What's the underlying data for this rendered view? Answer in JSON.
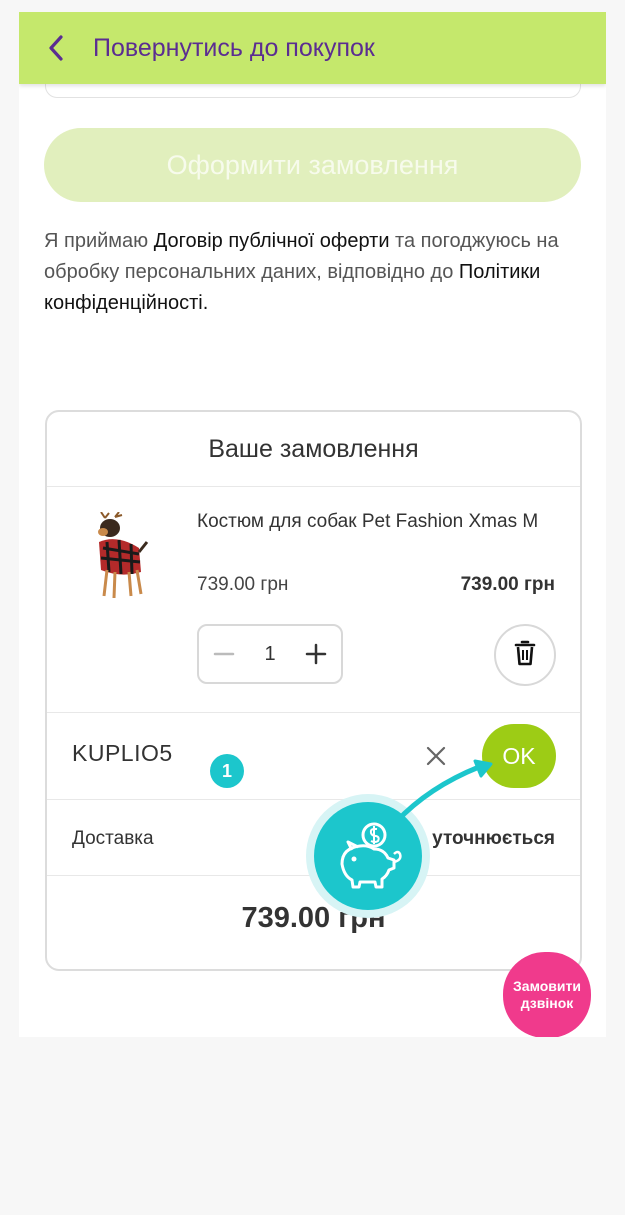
{
  "header": {
    "back_label": "Повернутись до покупок"
  },
  "checkout": {
    "button_label": "Оформити замовлення"
  },
  "consent": {
    "text_1": "Я приймаю ",
    "link_offer": "Договір публічної оферти",
    "text_2": " та погоджуюсь на обробку персональних даних, відповідно до ",
    "link_privacy": "Політики конфіденційності."
  },
  "order": {
    "title": "Ваше замовлення",
    "item": {
      "name": "Костюм для собак Pet Fashion Xmas M",
      "unit_price": "739.00 грн",
      "line_total": "739.00 грн",
      "quantity": "1"
    },
    "promo": {
      "code": "KUPLIO5",
      "step": "1",
      "apply_label": "OK"
    },
    "delivery": {
      "label": "Доставка",
      "value": "уточнюється"
    },
    "total": "739.00 грн"
  },
  "callback": {
    "label": "Замовити дзвінок"
  },
  "colors": {
    "accent_green": "#c5e86c",
    "ok_green": "#9dcc15",
    "brand_purple": "#5b2d91",
    "teal": "#1cc6cc",
    "pink": "#f03a8c"
  }
}
